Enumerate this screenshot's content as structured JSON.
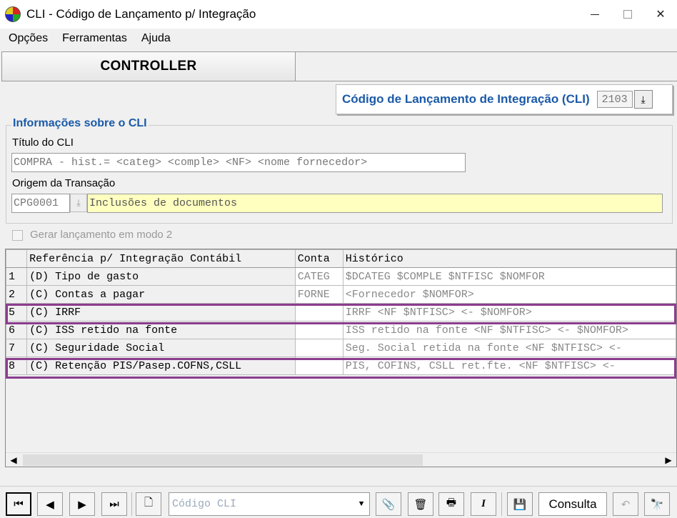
{
  "window": {
    "title": "CLI - Código de Lançamento p/ Integração"
  },
  "menu": [
    {
      "label": "Opções"
    },
    {
      "label": "Ferramentas"
    },
    {
      "label": "Ajuda"
    }
  ],
  "controller": {
    "label": "CONTROLLER"
  },
  "cli_header": {
    "label": "Código de Lançamento de Integração (CLI)",
    "code": "2103"
  },
  "info_group": {
    "title": "Informações sobre o CLI",
    "titulo_label": "Título do CLI",
    "titulo_value": "COMPRA - hist.= <categ> <comple> <NF> <nome fornecedor>",
    "origem_label": "Origem da Transação",
    "origem_code": "CPG0001",
    "origem_desc": "Inclusões de documentos"
  },
  "checkbox": {
    "label": "Gerar lançamento em modo 2",
    "checked": false
  },
  "grid": {
    "columns": [
      "Referência p/ Integração Contábil",
      "Conta",
      "Histórico"
    ],
    "rows": [
      {
        "idx": "1",
        "ref": "(D) Tipo de gasto",
        "conta": "CATEG",
        "hist": "$DCATEG $COMPLE $NTFISC $NOMFOR",
        "highlight": false
      },
      {
        "idx": "2",
        "ref": "(C) Contas a pagar",
        "conta": "FORNE",
        "hist": "<Fornecedor $NOMFOR>",
        "highlight": false
      },
      {
        "idx": "5",
        "ref": "(C) IRRF",
        "conta": "",
        "hist": "IRRF <NF $NTFISC> <- $NOMFOR>",
        "highlight": true
      },
      {
        "idx": "6",
        "ref": "(C) ISS retido na fonte",
        "conta": "",
        "hist": "ISS retido na fonte <NF $NTFISC> <- $NOMFOR>",
        "highlight": false
      },
      {
        "idx": "7",
        "ref": "(C) Seguridade Social",
        "conta": "",
        "hist": "Seg. Social retida na fonte <NF $NTFISC> <-",
        "highlight": false
      },
      {
        "idx": "8",
        "ref": "(C) Retenção PIS/Pasep.COFNS,CSLL",
        "conta": "",
        "hist": "PIS, COFINS, CSLL ret.fte.  <NF $NTFISC> <-",
        "highlight": true
      }
    ]
  },
  "toolbar": {
    "combo_placeholder": "Código CLI",
    "consulta_label": "Consulta"
  },
  "colors": {
    "accent": "#1a5aa8",
    "highlight_border": "#8b3d8e",
    "yellow_field": "#ffffc0"
  }
}
